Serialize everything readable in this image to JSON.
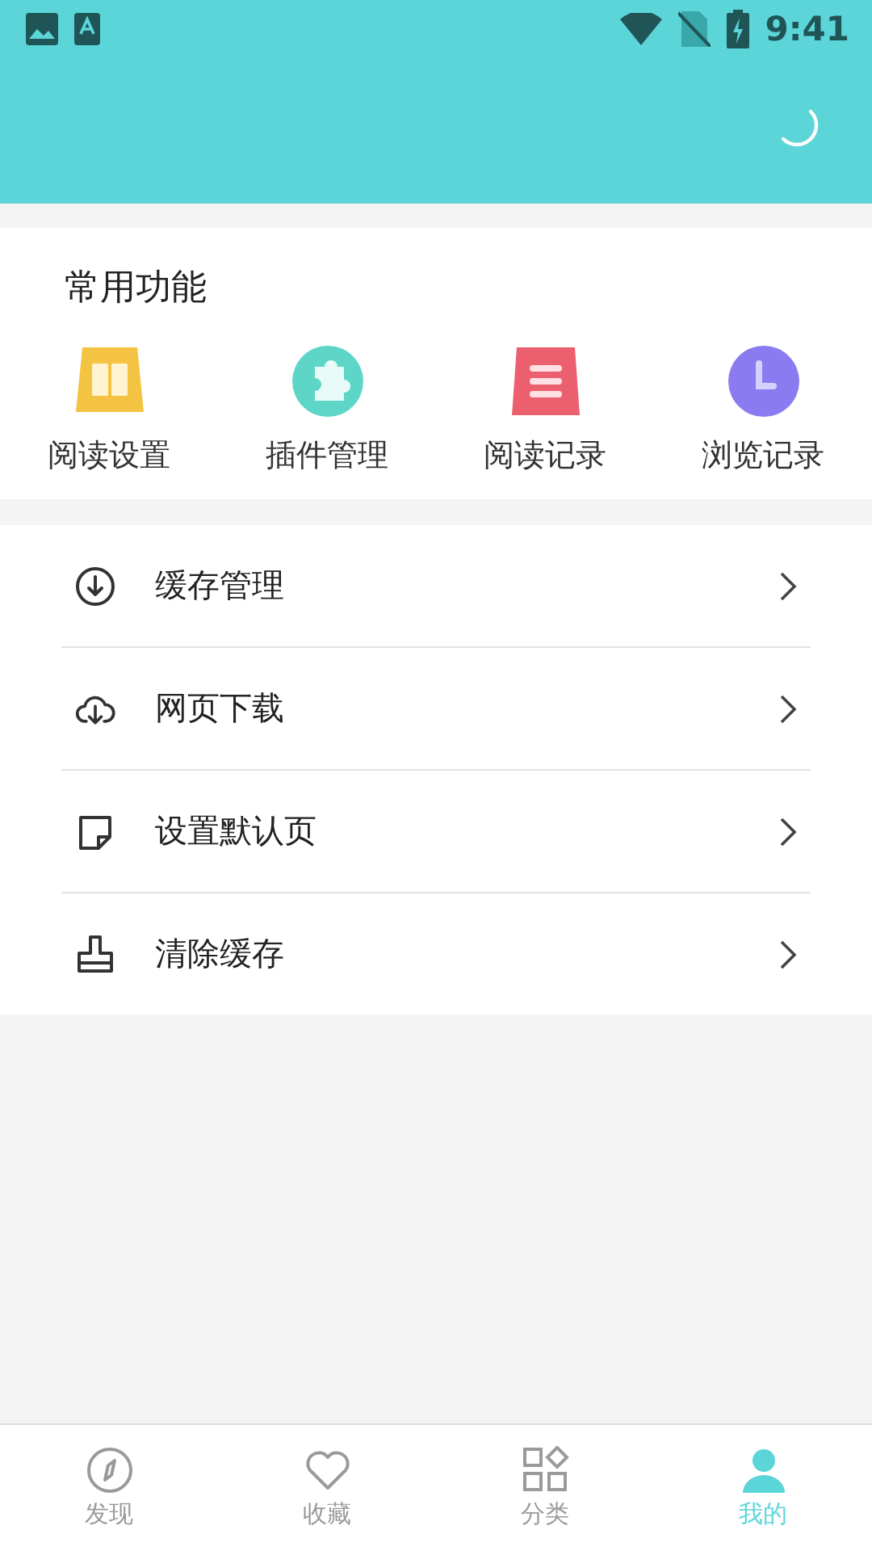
{
  "status_bar": {
    "time": "9:41"
  },
  "common_functions": {
    "title": "常用功能",
    "items": [
      {
        "label": "阅读设置",
        "kind": "book",
        "color": "#f5c342"
      },
      {
        "label": "插件管理",
        "kind": "puzzle",
        "color": "#5dd6c8"
      },
      {
        "label": "阅读记录",
        "kind": "list",
        "color": "#ec5f6e"
      },
      {
        "label": "浏览记录",
        "kind": "clock",
        "color": "#8a7cf0"
      }
    ]
  },
  "menu": [
    {
      "label": "缓存管理",
      "kind": "download"
    },
    {
      "label": "网页下载",
      "kind": "cloud"
    },
    {
      "label": "设置默认页",
      "kind": "page"
    },
    {
      "label": "清除缓存",
      "kind": "brush"
    }
  ],
  "bottom_nav": [
    {
      "label": "发现",
      "kind": "compass",
      "selected": false
    },
    {
      "label": "收藏",
      "kind": "heart",
      "selected": false
    },
    {
      "label": "分类",
      "kind": "grid",
      "selected": false
    },
    {
      "label": "我的",
      "kind": "person",
      "selected": true
    }
  ]
}
